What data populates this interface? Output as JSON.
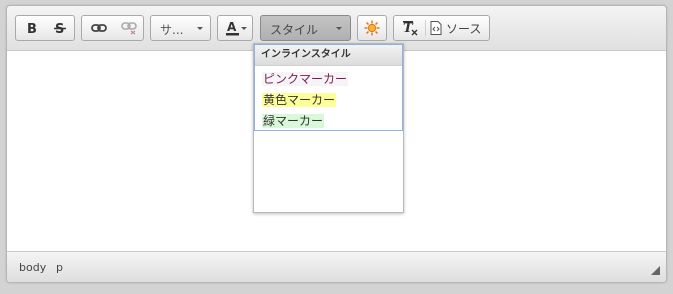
{
  "toolbar": {
    "font_combo_label": "サ...",
    "styles_combo_label": "スタイル",
    "source_label": "ソース"
  },
  "styles_menu": {
    "header": "インラインスタイル",
    "items": [
      {
        "label": "ピンクマーカー",
        "color": "#7a1a5a",
        "bg": "#f5f5f5"
      },
      {
        "label": "黄色マーカー",
        "color": "#333333",
        "bg": "#ffff99"
      },
      {
        "label": "緑マーカー",
        "color": "#333333",
        "bg": "#d9f7d9"
      }
    ]
  },
  "statusbar": {
    "path": [
      "body",
      "p"
    ]
  },
  "colors": {
    "text_color_underline": "#b7312c",
    "styles_combo_bg": "#bdbdbd"
  }
}
